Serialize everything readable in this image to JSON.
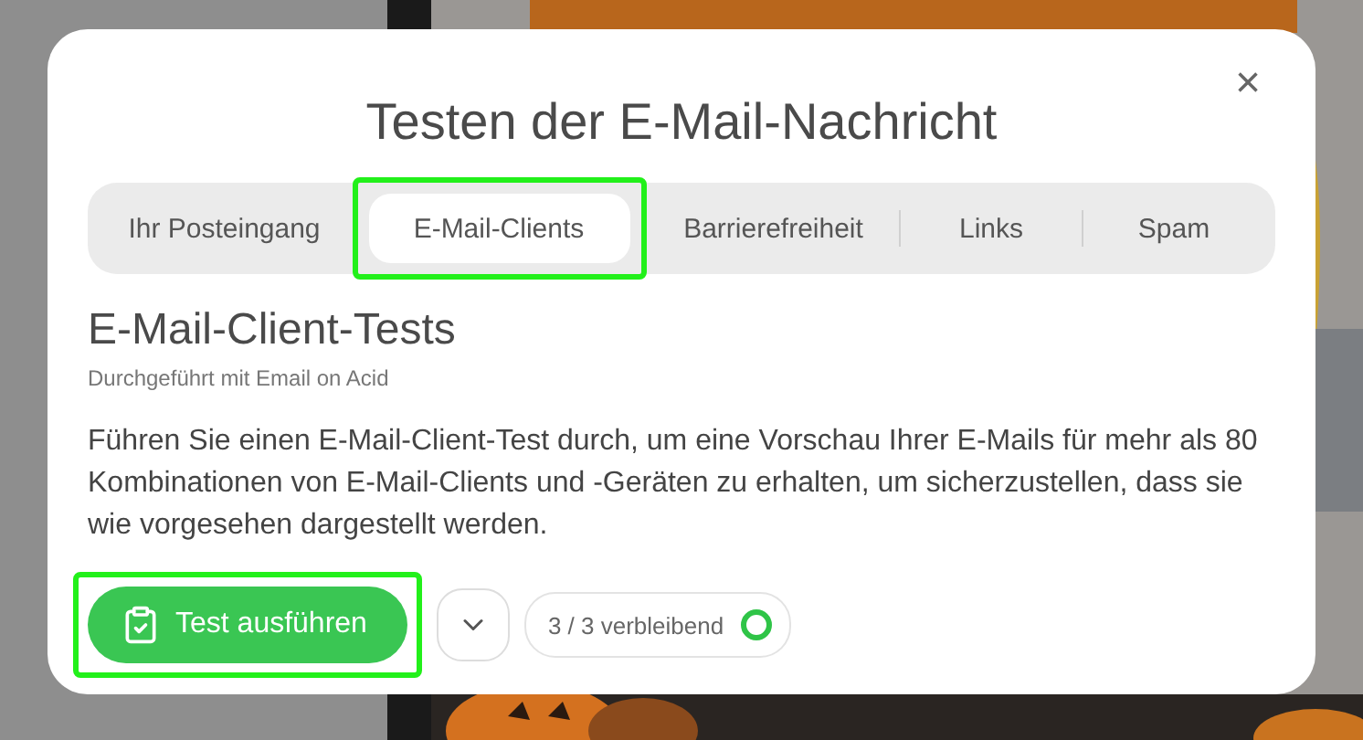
{
  "dialog": {
    "title": "Testen der E-Mail-Nachricht",
    "close": "×"
  },
  "tabs": [
    {
      "label": "Ihr Posteingang",
      "selected": false,
      "highlighted": false
    },
    {
      "label": "E-Mail-Clients",
      "selected": true,
      "highlighted": true
    },
    {
      "label": "Barrierefreiheit",
      "selected": false,
      "highlighted": false
    },
    {
      "label": "Links",
      "selected": false,
      "highlighted": false
    },
    {
      "label": "Spam",
      "selected": false,
      "highlighted": false
    }
  ],
  "section": {
    "heading": "E-Mail-Client-Tests",
    "subtitle": "Durchgeführt mit Email on Acid",
    "description": "Führen Sie einen E-Mail-Client-Test durch, um eine Vorschau Ihrer E-Mails für mehr als 80 Kombinationen von E-Mail-Clients und -Geräten zu erhalten, um sicherzustellen, dass sie wie vorgesehen dargestellt werden."
  },
  "run_button": {
    "label": "Test ausführen",
    "highlighted": true
  },
  "counter": {
    "label": "3 / 3 verbleibend"
  }
}
